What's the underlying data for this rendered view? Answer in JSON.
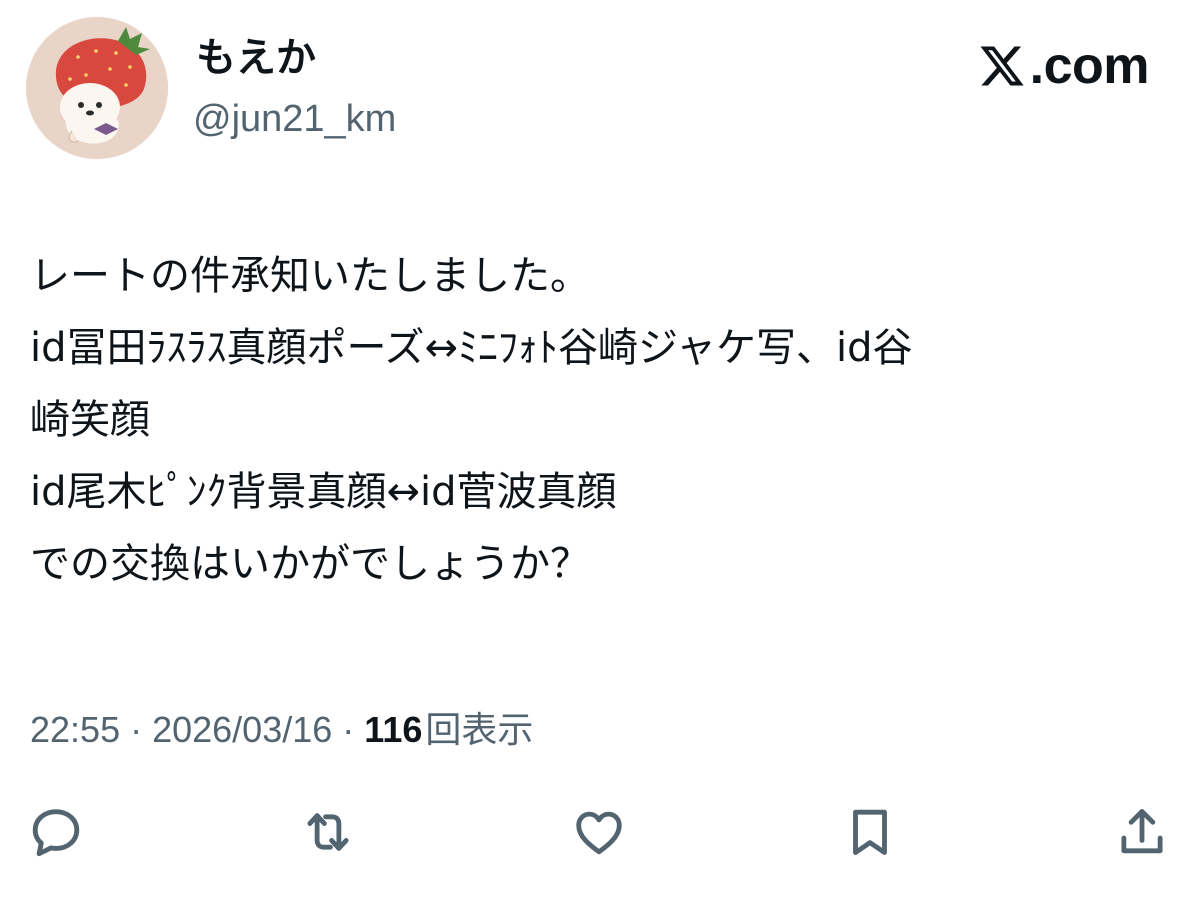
{
  "author": {
    "display_name": "もえか",
    "handle": "@jun21_km",
    "avatar_icon": "strawberry-character-avatar"
  },
  "brand": {
    "logo_icon": "x-logo-icon",
    "text": ".com"
  },
  "tweet": {
    "lines": [
      "レートの件承知いたしました。",
      "id冨田ﾗｽﾗｽ真顔ポーズ↔ﾐﾆﾌｫﾄ谷崎ジャケ写、id谷",
      "崎笑顔",
      "id尾木ﾋﾟﾝｸ背景真顔↔id菅波真顔",
      "での交換はいかがでしょうか？"
    ]
  },
  "meta": {
    "time": "22:55",
    "separator": " · ",
    "date": "2026/03/16",
    "views_count": "116",
    "views_label": "回表示"
  },
  "actions": [
    {
      "name": "reply-icon"
    },
    {
      "name": "retweet-icon"
    },
    {
      "name": "like-icon"
    },
    {
      "name": "bookmark-icon"
    },
    {
      "name": "share-icon"
    }
  ],
  "colors": {
    "text_primary": "#0f1419",
    "text_secondary": "#536471",
    "background": "#ffffff"
  }
}
